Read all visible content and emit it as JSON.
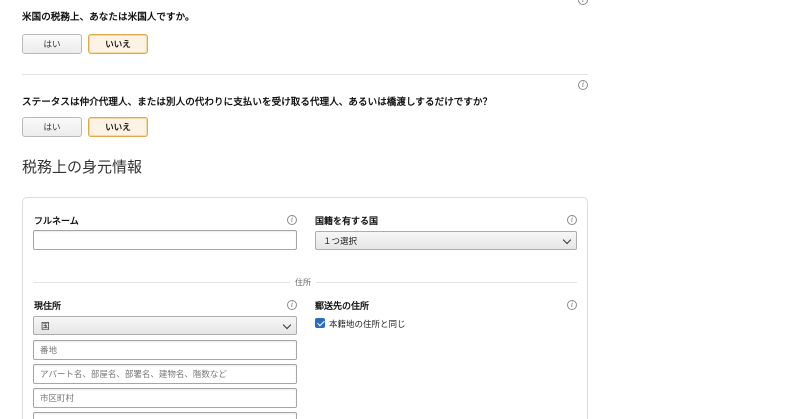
{
  "q1": {
    "text": "米国の税務上、あなたは米国人ですか。",
    "yes": "はい",
    "no": "いいえ",
    "selected": "no"
  },
  "q2": {
    "text": "ステータスは仲介代理人、または別人の代わりに支払いを受け取る代理人、あるいは橋渡しするだけですか？",
    "yes": "はい",
    "no": "いいえ",
    "selected": "no"
  },
  "section": {
    "title": "税務上の身元情報"
  },
  "form": {
    "full_name_label": "フルネーム",
    "full_name_value": "",
    "nationality_label": "国籍を有する国",
    "nationality_value": "１つ選択",
    "address_divider": "住所",
    "current_address_label": "現住所",
    "country_value": "国",
    "street_placeholder": "番地",
    "apartment_placeholder": "アパート名、部屋名、部署名、建物名、階数など",
    "city_placeholder": "市区町村",
    "mailing_label": "郵送先の住所",
    "same_as_permanent_label": "本籍地の住所と同じ",
    "same_as_permanent_checked": true
  },
  "icons": {
    "info": "info-icon",
    "info_glyph": "i"
  },
  "colors": {
    "selected_border": "#e3a64a",
    "selected_bg": "#fdf3e4",
    "checkbox": "#2a6cbf"
  }
}
